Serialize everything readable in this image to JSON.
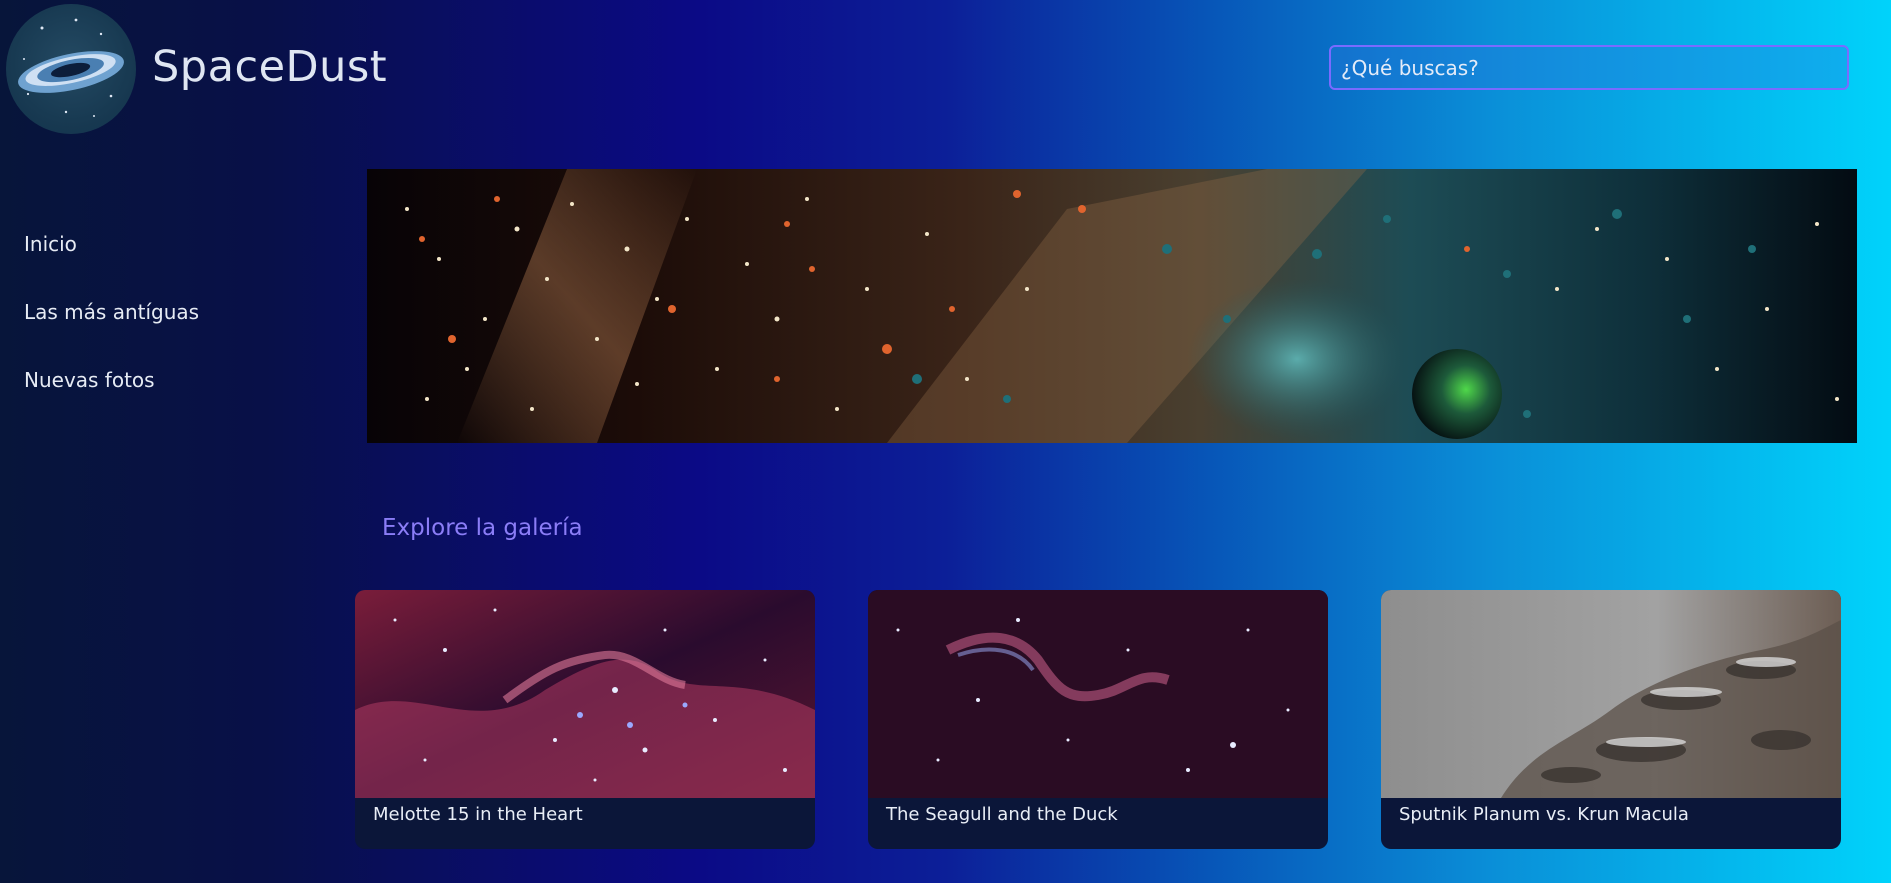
{
  "brand": {
    "name": "SpaceDust",
    "logo_icon": "galaxy-logo-icon"
  },
  "search": {
    "placeholder": "¿Qué buscas?",
    "value": ""
  },
  "nav": {
    "items": [
      {
        "label": "Inicio"
      },
      {
        "label": "Las más antíguas"
      },
      {
        "label": "Nuevas fotos"
      }
    ]
  },
  "hero": {
    "image": "space-banner-image"
  },
  "gallery": {
    "title": "Explore la galería",
    "cards": [
      {
        "title": "Melotte 15 in the Heart",
        "image": "nebula-image"
      },
      {
        "title": "The Seagull and the Duck",
        "image": "nebula-image"
      },
      {
        "title": "Sputnik Planum vs. Krun Macula",
        "image": "planet-surface-image"
      }
    ]
  },
  "colors": {
    "accent": "#8b7df7",
    "search_border": "#7a6bff",
    "card_bg": "#0b1639"
  }
}
